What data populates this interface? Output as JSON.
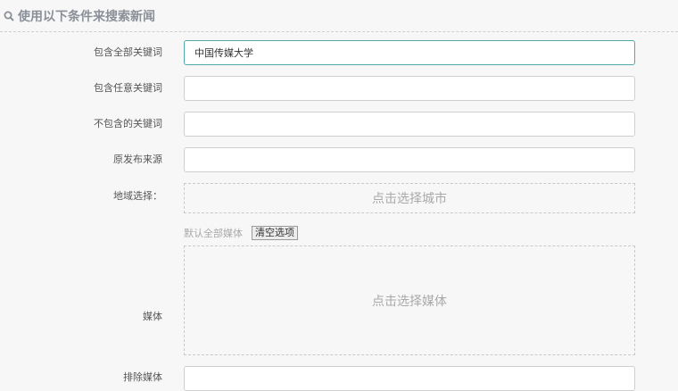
{
  "header": {
    "title": "使用以下条件来搜索新闻",
    "icon": "search-icon"
  },
  "form": {
    "all_keywords": {
      "label": "包含全部关键词",
      "value": "中国传媒大学"
    },
    "any_keywords": {
      "label": "包含任意关键词",
      "value": ""
    },
    "exclude_keywords": {
      "label": "不包含的关键词",
      "value": ""
    },
    "source": {
      "label": "原发布来源",
      "value": ""
    },
    "region": {
      "label": "地域选择：",
      "picker_text": "点击选择城市"
    },
    "media": {
      "label": "媒体",
      "default_hint": "默认全部媒体",
      "clear_label": "清空选项",
      "picker_text": "点击选择媒体"
    },
    "exclude_media": {
      "label": "排除媒体",
      "value": ""
    }
  },
  "colors": {
    "focus_border": "#4fa9a7",
    "title": "#8a8f98"
  }
}
